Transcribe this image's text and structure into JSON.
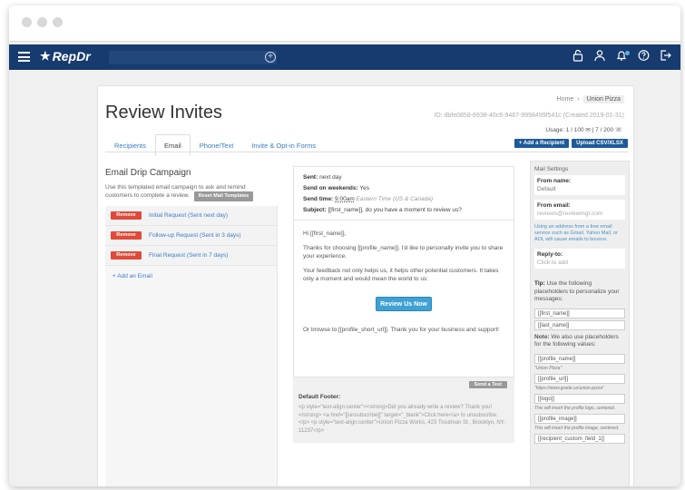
{
  "app": {
    "brand": "RepDr"
  },
  "page": {
    "title": "Review Invites",
    "breadcrumb": {
      "home": "Home",
      "current": "Union Pizza"
    },
    "id_line": "ID: dbfe0858-6938-40c6-9487-9998499f541c (Created 2019-01-31)",
    "usage": "Usage: 1 / 100 ✉ | 7 / 200 ☏"
  },
  "tabs": [
    {
      "label": "Recipients"
    },
    {
      "label": "Email"
    },
    {
      "label": "Phone/Text"
    },
    {
      "label": "Invite & Opt-in Forms"
    }
  ],
  "buttons": {
    "add_recipient": "+ Add a Recipient",
    "upload": "Upload CSV/XLSX"
  },
  "drip": {
    "title": "Email Drip Campaign",
    "description": "Use this templated email campaign to ask and remind customers to complete a review.",
    "reset_label": "Reset Mail Templates",
    "remove_label": "Remove",
    "items": [
      {
        "label": "Initial Request (Sent next day)"
      },
      {
        "label": "Follow-up Request (Sent in 3 days)"
      },
      {
        "label": "Final Request (Sent in 7 days)"
      }
    ],
    "add_label": "+ Add an Email"
  },
  "email": {
    "sent_label": "Sent:",
    "sent_value": "next day",
    "weekends_label": "Send on weekends:",
    "weekends_value": "Yes",
    "time_label": "Send time:",
    "time_value": "9:00am",
    "time_zone": "Eastern Time (US & Canada)",
    "subject_label": "Subject:",
    "subject_value": "[[first_name]], do you have a moment to review us?",
    "greeting": "Hi [[first_name]],",
    "para1": "Thanks for choosing [[profile_name]]. I'd like to personally invite you to share your experience.",
    "para2": "Your feedback not only helps us, it helps other potential customers. It takes only a moment and would mean the world to us:",
    "button": "Review Us Now",
    "closing": "Or browse to [[profile_short_url]]. Thank you for your business and support!",
    "send_test": "Send a Test",
    "footer_label": "Default Footer:",
    "footer_code": "<p style=\"text-align:center\"><strong>Did you already write a review? Thank you!</strong> <a href=\"[[unsubscribe]]\" target=\"_blank\">Click here</a> to unsubscribe.</p> <p style=\"text-align:center\">Union Pizza Works, 423 Troutman St , Brooklyn, NY, 11237</p>"
  },
  "settings": {
    "title": "Mail Settings",
    "from_name_label": "From name:",
    "from_name_value": "Default",
    "from_email_label": "From email:",
    "from_email_placeholder": "reviews@reviewmgr.com",
    "from_email_hint": "Using an address from a free email service such as Gmail, Yahoo Mail, or AOL will cause emails to bounce.",
    "reply_label": "Reply-to:",
    "reply_placeholder": "Click to add",
    "tip_bold": "Tip:",
    "tip_text": " Use the following placeholders to personalize your messages:",
    "placeholders": [
      "[[first_name]]",
      "[[last_name]]"
    ],
    "note_bold": "Note:",
    "note_text": " We also use placeholders for the following values:",
    "values": [
      {
        "field": "[[profile_name]]",
        "desc": "\"Union Pizza\""
      },
      {
        "field": "[[profile_url]]",
        "desc": "\"https://www.grade.us/union-pizza\""
      },
      {
        "field": "[[logo]]",
        "desc": "This will insert the profile logo, centered."
      },
      {
        "field": "[[profile_image]]",
        "desc": "This will insert the profile image, centered."
      },
      {
        "field": "[[recipient_custom_field_1]]",
        "desc": ""
      }
    ]
  }
}
